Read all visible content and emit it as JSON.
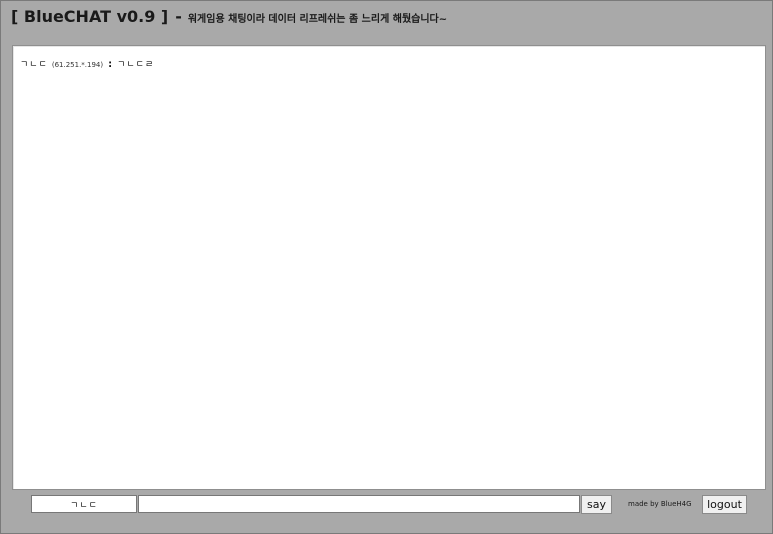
{
  "header": {
    "title": "[ BlueCHAT v0.9 ]",
    "separator": "-",
    "subtitle": "워게임용 채팅이라 데이터 리프레쉬는 좀 느리게 해뒀습니다~"
  },
  "messages": [
    {
      "name": "ㄱㄴㄷ",
      "ip": "(61.251.*.194)",
      "separator": ":",
      "text": "ㄱㄴㄷㄹ"
    }
  ],
  "input": {
    "name_value": "ㄱㄴㄷ",
    "message_value": "",
    "message_placeholder": ""
  },
  "buttons": {
    "say": "say",
    "logout": "logout"
  },
  "footer": {
    "made_by": "made by BlueH4G"
  },
  "colors": {
    "background": "#a9a9a9",
    "chat_background": "#ffffff"
  }
}
